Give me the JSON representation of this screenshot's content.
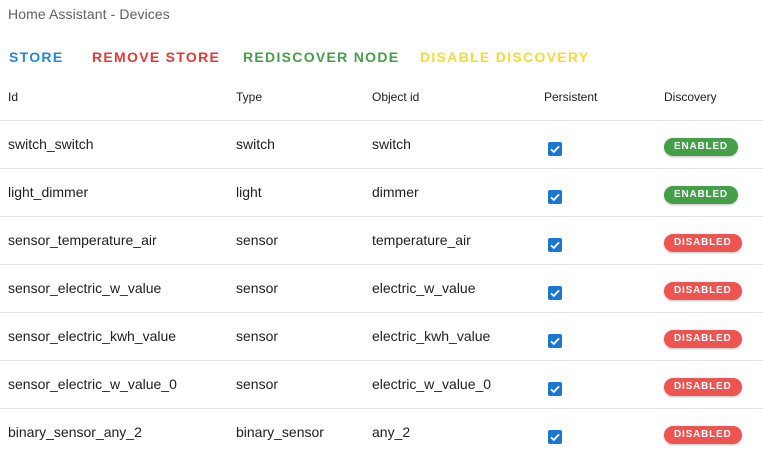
{
  "app": {
    "title": "Home Assistant - Devices"
  },
  "toolbar": {
    "store_label": "STORE",
    "remove_store_label": "REMOVE STORE",
    "rediscover_node_label": "REDISCOVER NODE",
    "disable_discovery_label": "DISABLE DISCOVERY",
    "store_color": "#1e88e5",
    "remove_store_color": "#e53935",
    "rediscover_node_color": "#43a047",
    "disable_discovery_color": "#fdd835"
  },
  "table": {
    "headers": {
      "id": "Id",
      "type": "Type",
      "object_id": "Object id",
      "persistent": "Persistent",
      "discovery": "Discovery"
    },
    "rows": [
      {
        "id": "switch_switch",
        "type": "switch",
        "object_id": "switch",
        "persistent": true,
        "discovery": "ENABLED"
      },
      {
        "id": "light_dimmer",
        "type": "light",
        "object_id": "dimmer",
        "persistent": true,
        "discovery": "ENABLED"
      },
      {
        "id": "sensor_temperature_air",
        "type": "sensor",
        "object_id": "temperature_air",
        "persistent": true,
        "discovery": "DISABLED"
      },
      {
        "id": "sensor_electric_w_value",
        "type": "sensor",
        "object_id": "electric_w_value",
        "persistent": true,
        "discovery": "DISABLED"
      },
      {
        "id": "sensor_electric_kwh_value",
        "type": "sensor",
        "object_id": "electric_kwh_value",
        "persistent": true,
        "discovery": "DISABLED"
      },
      {
        "id": "sensor_electric_w_value_0",
        "type": "sensor",
        "object_id": "electric_w_value_0",
        "persistent": true,
        "discovery": "DISABLED"
      },
      {
        "id": "binary_sensor_any_2",
        "type": "binary_sensor",
        "object_id": "any_2",
        "persistent": true,
        "discovery": "DISABLED"
      }
    ]
  },
  "colors": {
    "checkbox": "#1976d2",
    "enabled_badge": "#43a047",
    "disabled_badge": "#ef5350"
  }
}
